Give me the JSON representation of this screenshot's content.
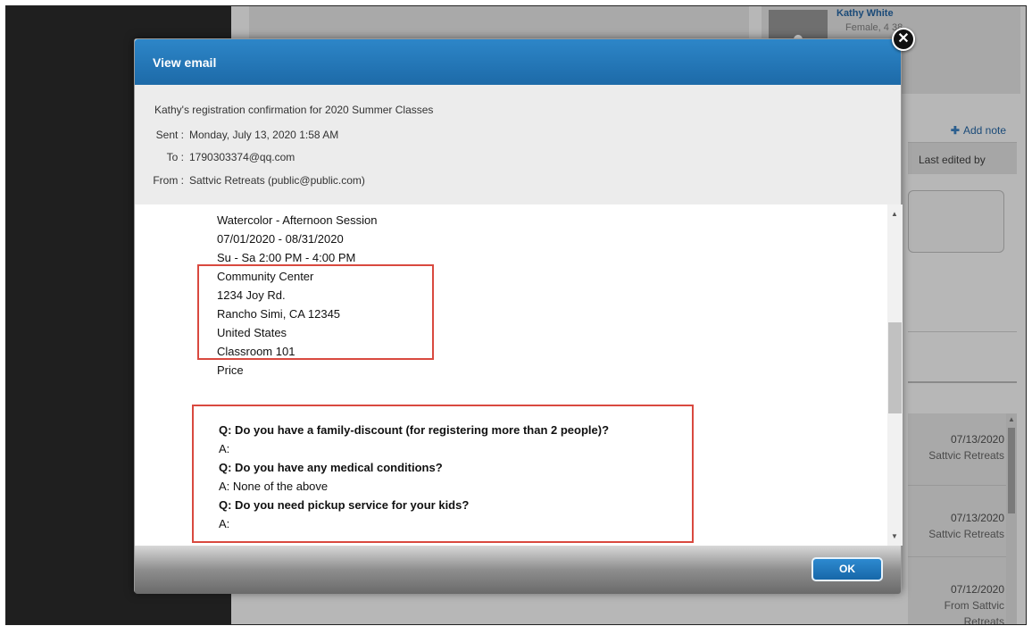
{
  "backdrop": {
    "profile": {
      "name": "Kathy White",
      "meta": "Female, 4 38"
    },
    "add_note": "Add note",
    "last_edited": "Last edited by",
    "history": [
      {
        "date": "07/13/2020",
        "from": "Sattvic Retreats"
      },
      {
        "date": "07/13/2020",
        "from": "Sattvic Retreats"
      },
      {
        "date": "07/12/2020",
        "from": "From Sattvic Retreats"
      }
    ]
  },
  "modal": {
    "title": "View email",
    "close_glyph": "✕",
    "subject": "Kathy's registration confirmation for 2020 Summer Classes",
    "sent_label": "Sent :",
    "sent_value": "Monday, July 13, 2020 1:58 AM",
    "to_label": "To :",
    "to_value": "1790303374@qq.com",
    "from_label": "From :",
    "from_value": "Sattvic Retreats (public@public.com)",
    "body": {
      "class_lines": [
        "Watercolor - Afternoon Session",
        "07/01/2020 - 08/31/2020",
        "Su - Sa 2:00 PM - 4:00 PM",
        "Community Center",
        "1234 Joy Rd.",
        "Rancho Simi, CA 12345",
        "United States",
        "Classroom 101",
        "Price"
      ],
      "qa": [
        {
          "q": "Q: Do you have a family-discount (for registering more than 2 people)?",
          "a": "A:"
        },
        {
          "q": "Q: Do you have any medical conditions?",
          "a": "A: None of the above"
        },
        {
          "q": "Q: Do you need pickup service for your kids?",
          "a": "A:"
        }
      ]
    },
    "ok_label": "OK"
  },
  "colors": {
    "header_blue": "#1d6aa8",
    "highlight_red": "#d9493f",
    "link_blue": "#1a4a78"
  }
}
